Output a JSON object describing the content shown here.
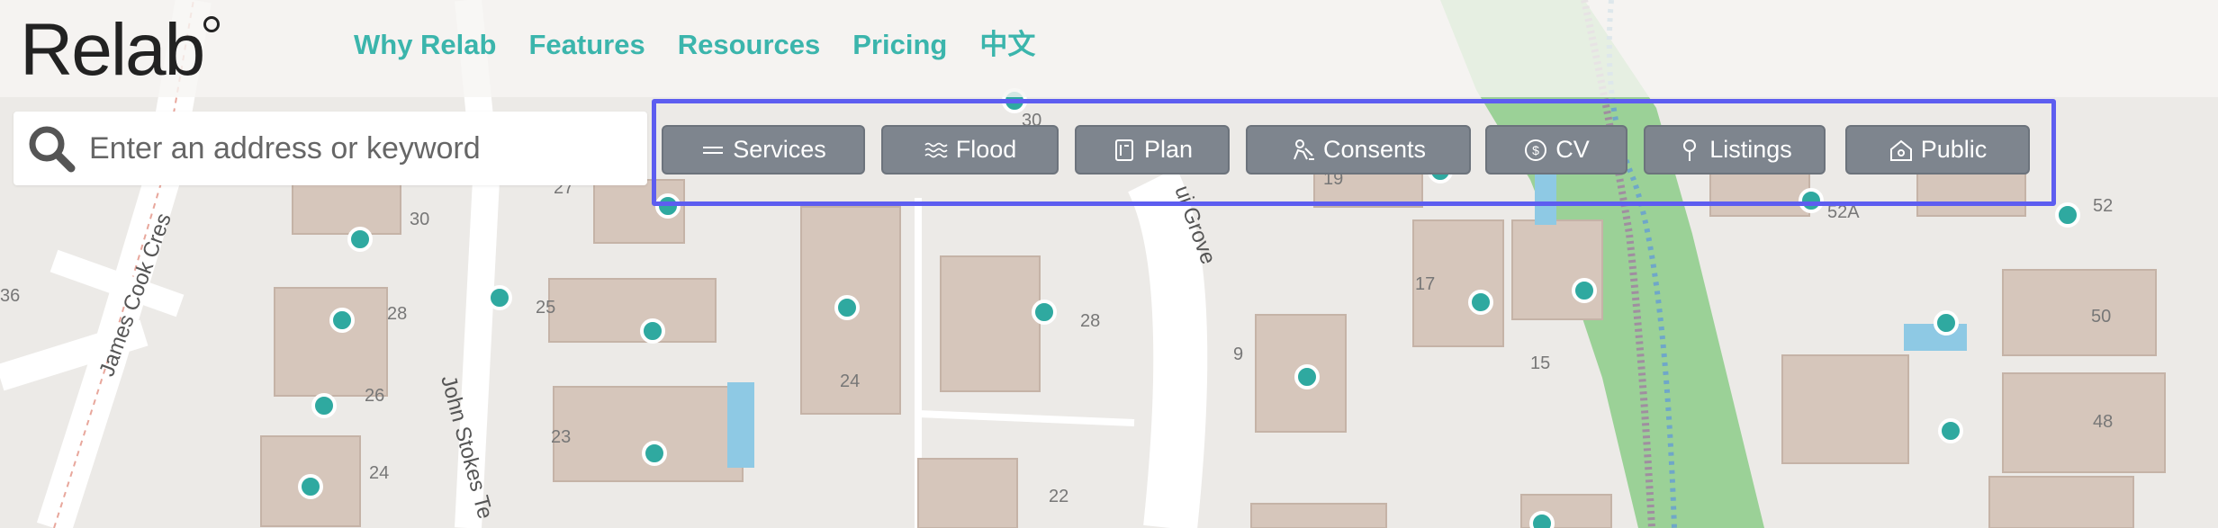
{
  "brand": {
    "name": "Relab"
  },
  "nav": {
    "items": [
      {
        "label": "Why Relab"
      },
      {
        "label": "Features"
      },
      {
        "label": "Resources"
      },
      {
        "label": "Pricing"
      },
      {
        "label": "中文"
      }
    ]
  },
  "search": {
    "placeholder": "Enter an address or keyword",
    "icon": "search-icon"
  },
  "layers": [
    {
      "label": "Services",
      "icon": "lines-icon"
    },
    {
      "label": "Flood",
      "icon": "waves-icon"
    },
    {
      "label": "Plan",
      "icon": "document-icon"
    },
    {
      "label": "Consents",
      "icon": "builder-icon"
    },
    {
      "label": "CV",
      "icon": "dollar-icon"
    },
    {
      "label": "Listings",
      "icon": "pin-icon"
    },
    {
      "label": "Public",
      "icon": "house-icon"
    }
  ],
  "map": {
    "streets": [
      "James Cook Cres",
      "John Stokes Te",
      "ui Grove"
    ],
    "house_numbers": [
      "30",
      "27",
      "30",
      "19",
      "52A",
      "52",
      "36",
      "28",
      "25",
      "24",
      "28",
      "17",
      "15",
      "9",
      "50",
      "26",
      "23",
      "48",
      "24",
      "22"
    ]
  },
  "colors": {
    "accent": "#3bb5ac",
    "marker": "#2fa9a0",
    "button": "#7e858e",
    "highlight": "#5d5df0",
    "park": "#8fc98c",
    "building": "#d8c9be"
  }
}
